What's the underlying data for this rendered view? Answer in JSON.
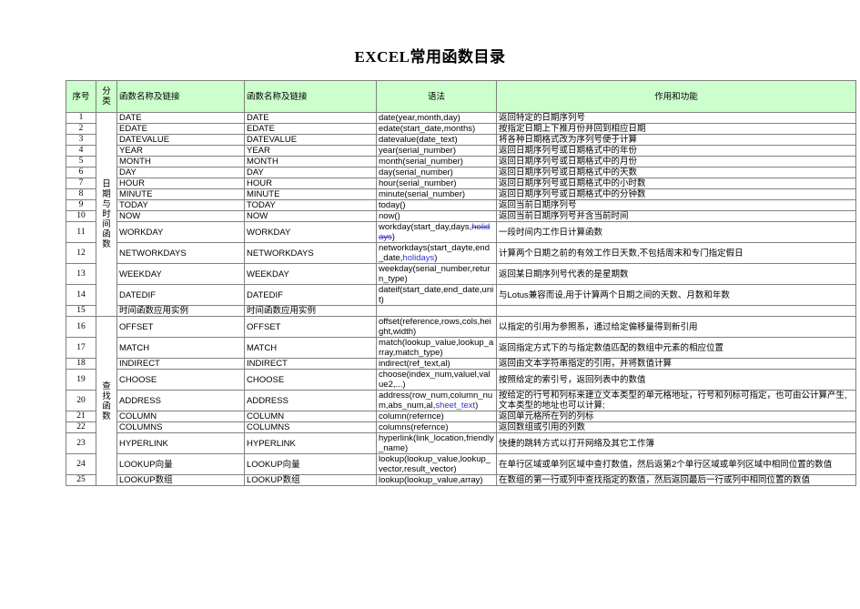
{
  "document": {
    "title": "EXCEL常用函数目录"
  },
  "colors": {
    "header_fill": "#ccffcc",
    "function_text": "#ff3333",
    "link_text": "#3333cc",
    "grid_line": "#808080",
    "frame_line": "#000000",
    "page_background": "#ffffff"
  },
  "table": {
    "headers": [
      "序号",
      "分类",
      "函数名称及链接",
      "函数名称及链接",
      "语法",
      "作用和功能"
    ],
    "categories": [
      {
        "label": "日期与时间函数",
        "rows": 15
      },
      {
        "label": "查找函数",
        "rows": 10
      }
    ],
    "rows": [
      {
        "no": "1",
        "fn1": "DATE",
        "fn2": "DATE",
        "syntax": "date(year,month,day)",
        "desc": "返回特定的日期序列号"
      },
      {
        "no": "2",
        "fn1": "EDATE",
        "fn2": "EDATE",
        "syntax": "edate(start_date,months)",
        "desc": "按指定日期上下推月份并回到相应日期"
      },
      {
        "no": "3",
        "fn1": "DATEVALUE",
        "fn2": "DATEVALUE",
        "syntax": "datevalue(date_text)",
        "desc": "将各种日期格式改为序列号便于计算"
      },
      {
        "no": "4",
        "fn1": "YEAR",
        "fn2": "YEAR",
        "syntax": "year(serial_number)",
        "desc": "返回日期序列号或日期格式中的年份"
      },
      {
        "no": "5",
        "fn1": "MONTH",
        "fn2": "MONTH",
        "syntax": "month(serial_number)",
        "desc": "返回日期序列号或日期格式中的月份"
      },
      {
        "no": "6",
        "fn1": "DAY",
        "fn2": "DAY",
        "syntax": "day(serial_number)",
        "desc": "返回日期序列号或日期格式中的天数"
      },
      {
        "no": "7",
        "fn1": "HOUR",
        "fn2": "HOUR",
        "syntax": "hour(serial_number)",
        "desc": "返回日期序列号或日期格式中的小时数"
      },
      {
        "no": "8",
        "fn1": "MINUTE",
        "fn2": "MINUTE",
        "syntax": "minute(serial_number)",
        "desc": "返回日期序列号或日期格式中的分钟数"
      },
      {
        "no": "9",
        "fn1": "TODAY",
        "fn2": "TODAY",
        "syntax": "today()",
        "desc": "返回当前日期序列号"
      },
      {
        "no": "10",
        "fn1": "NOW",
        "fn2": "NOW",
        "syntax": "now()",
        "desc": "返回当前日期序列号并含当前时间"
      },
      {
        "no": "11",
        "fn1": "WORKDAY",
        "fn2": "WORKDAY",
        "syntax_parts": [
          {
            "text": "workday(start_day,days,",
            "style": "plain"
          },
          {
            "text": "holidays",
            "style": "link-strike"
          },
          {
            "text": ")",
            "style": "plain"
          }
        ],
        "syntax": "workday(start_day,days,holidays)",
        "desc": "一段时间内工作日计算函数"
      },
      {
        "no": "12",
        "fn1": "NETWORKDAYS",
        "fn2": "NETWORKDAYS",
        "syntax_parts": [
          {
            "text": "networkdays(start_dayte,end_date,",
            "style": "plain"
          },
          {
            "text": "holidays",
            "style": "link"
          },
          {
            "text": ")",
            "style": "plain"
          }
        ],
        "syntax": "networkdays(start_dayte,end_date,holidays)",
        "desc": "计算两个日期之前的有效工作日天数,不包括周末和专门指定假日"
      },
      {
        "no": "13",
        "fn1": "WEEKDAY",
        "fn2": "WEEKDAY",
        "syntax": "weekday(serial_number,return_type)",
        "desc": "返回某日期序列号代表的是星期数"
      },
      {
        "no": "14",
        "fn1": "DATEDIF",
        "fn2": "DATEDIF",
        "syntax": "dateif(start_date,end_date,unit)",
        "desc": "与Lotus兼容而设,用于计算两个日期之间的天数、月数和年数"
      },
      {
        "no": "15",
        "fn1": "时间函数应用实例",
        "fn2": "时间函数应用实例",
        "syntax": "",
        "desc": ""
      },
      {
        "no": "16",
        "fn1": "OFFSET",
        "fn2": "OFFSET",
        "syntax": "offset(reference,rows,cols,height,width)",
        "desc": "以指定的引用为参照系，通过给定偏移量得到新引用"
      },
      {
        "no": "17",
        "fn1": "MATCH",
        "fn2": "MATCH",
        "syntax": "match(lookup_value,lookup_array,match_type)",
        "desc": "返回指定方式下的与指定数值匹配的数组中元素的相应位置"
      },
      {
        "no": "18",
        "fn1": "INDIRECT",
        "fn2": "INDIRECT",
        "syntax": "indirect(ref_text,al)",
        "desc": "返回由文本字符串指定的引用，并将数值计算"
      },
      {
        "no": "19",
        "fn1": "CHOOSE",
        "fn2": "CHOOSE",
        "syntax": "choose(index_num,valuel,value2,...)",
        "desc": "按照给定的索引号，返回列表中的数值"
      },
      {
        "no": "20",
        "fn1": "ADDRESS",
        "fn2": "ADDRESS",
        "syntax_parts": [
          {
            "text": "address(row_num,column_num,abs_num,al,",
            "style": "plain"
          },
          {
            "text": "sheet_text",
            "style": "link"
          },
          {
            "text": ")",
            "style": "plain"
          }
        ],
        "syntax": "address(row_num,column_num,abs_num,al,sheet_text)",
        "desc": "按给定的行号和列标来建立文本类型的单元格地址，行号和列标可指定，也可由公计算产生,文本类型的地址也可以计算;"
      },
      {
        "no": "21",
        "fn1": "COLUMN",
        "fn2": "COLUMN",
        "syntax": "column(refernce)",
        "desc": "返回单元格所在列的列标"
      },
      {
        "no": "22",
        "fn1": "COLUMNS",
        "fn2": "COLUMNS",
        "syntax": "columns(refernce)",
        "desc": "返回数组或引用的列数"
      },
      {
        "no": "23",
        "fn1": "HYPERLINK",
        "fn2": "HYPERLINK",
        "syntax": "hyperlink(link_location,friendly_name)",
        "desc": "快捷的跳转方式以打开网络及其它工作簿"
      },
      {
        "no": "24",
        "fn1": "LOOKUP向量",
        "fn2": "LOOKUP向量",
        "syntax": "lookup(lookup_value,lookup_vector,result_vector)",
        "desc": "在单行区域或单列区域中查打数值，然后返第2个单行区域或单列区域中相同位置的数值"
      },
      {
        "no": "25",
        "fn1": "LOOKUP数组",
        "fn2": "LOOKUP数组",
        "syntax": "lookup(lookup_value,array)",
        "desc": "在数组的第一行或列中查找指定的数值，然后返回最后一行或列中相同位置的数值"
      }
    ]
  }
}
